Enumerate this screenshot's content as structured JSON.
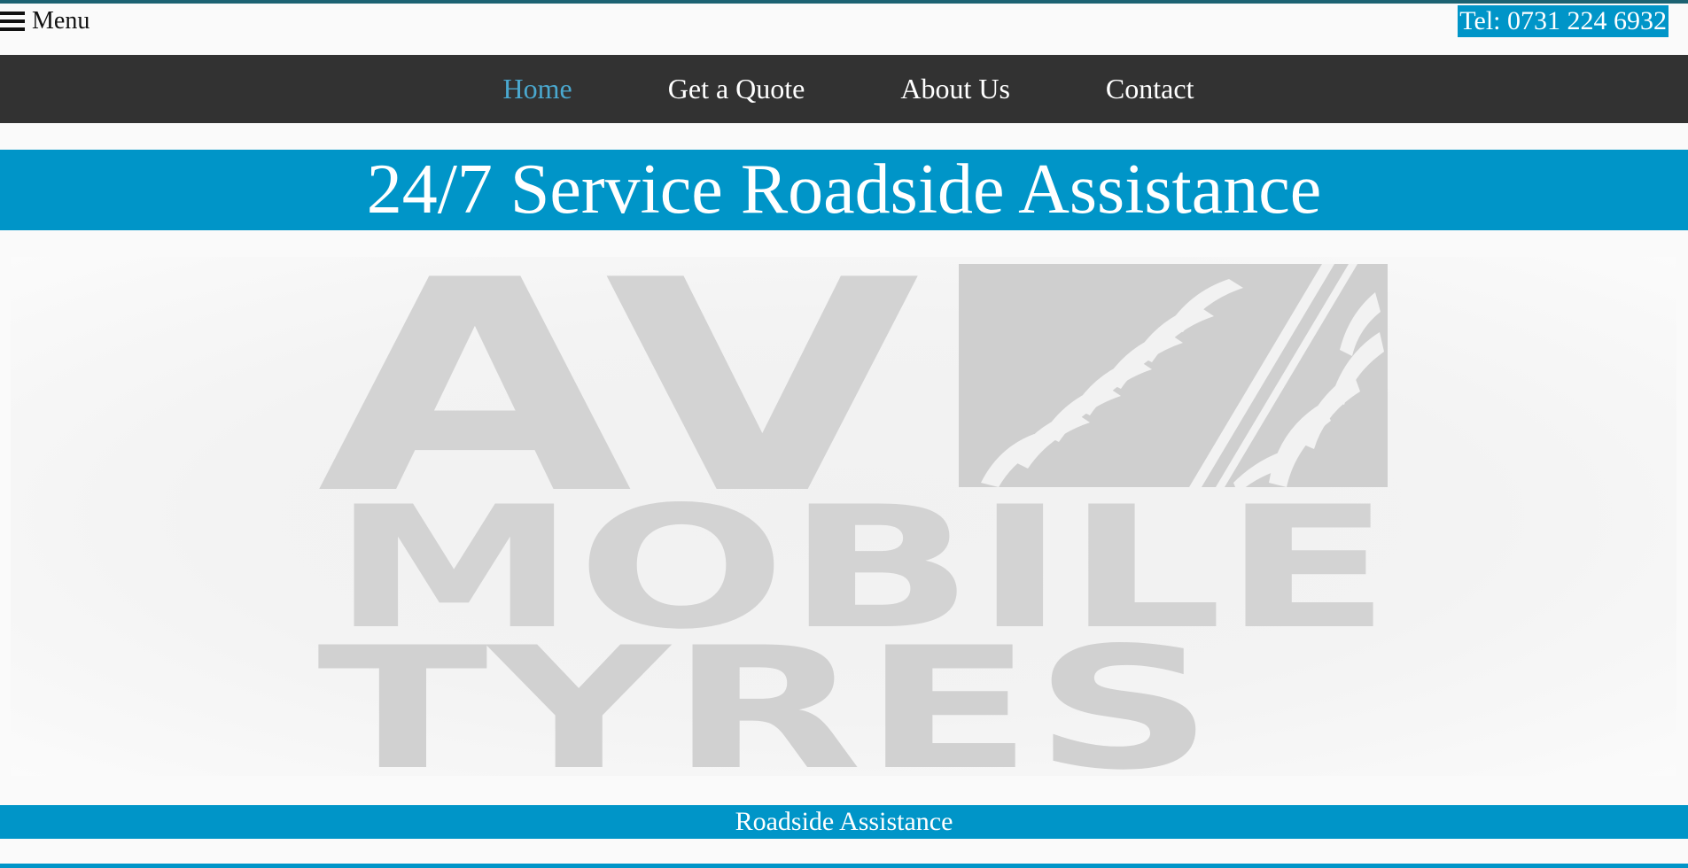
{
  "header": {
    "menu_label": "Menu",
    "menu_icon": "hamburger-icon",
    "phone": "Tel: 0731 224 6932"
  },
  "nav": {
    "items": [
      {
        "label": "Home",
        "active": true
      },
      {
        "label": "Get a Quote",
        "active": false
      },
      {
        "label": "About Us",
        "active": false
      },
      {
        "label": "Contact",
        "active": false
      }
    ]
  },
  "hero": {
    "title": "24/7 Service Roadside Assistance"
  },
  "logo": {
    "line1": "AV",
    "line2": "MOBILE",
    "line3": "TYRES"
  },
  "footer_band": {
    "label": "Roadside Assistance"
  },
  "colors": {
    "accent": "#0095c8",
    "nav_bg": "#323232",
    "nav_active": "#4aa8cf",
    "top_rule": "#1c6272",
    "logo_gray": "#d0d0d0"
  }
}
